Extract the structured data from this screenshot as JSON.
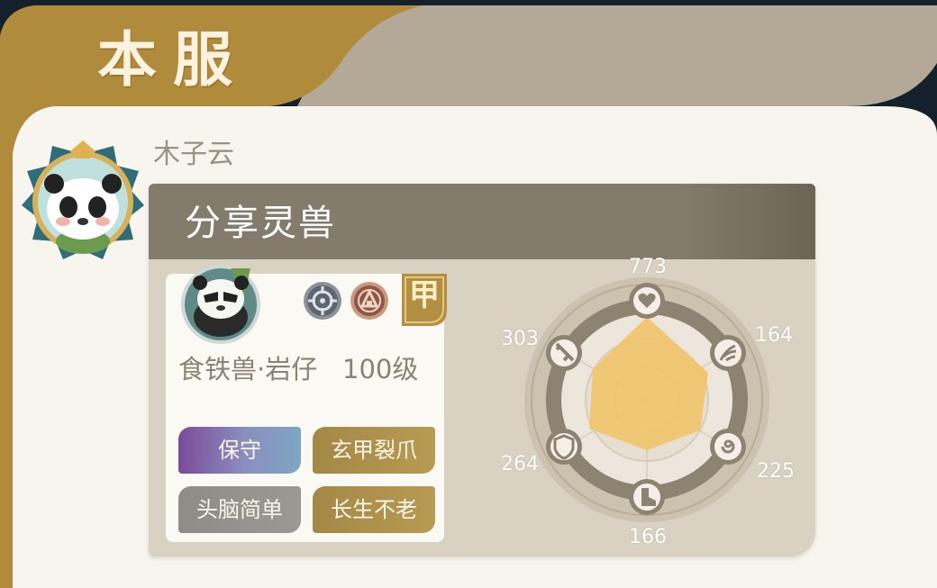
{
  "header": {
    "title": "本服"
  },
  "user": {
    "name": "木子云"
  },
  "card": {
    "title": "分享灵兽",
    "pet": {
      "name": "食铁兽·岩仔",
      "level": "100级",
      "grade": "甲",
      "traits": [
        "保守",
        "玄甲裂爪",
        "头脑简单",
        "长生不老"
      ]
    },
    "stats": {
      "top": "773",
      "top_right": "164",
      "bottom_right": "225",
      "bottom": "166",
      "bottom_left": "264",
      "top_left": "303"
    },
    "stat_icons": [
      "heart-icon",
      "claw-icon",
      "spiral-icon",
      "boot-icon",
      "shield-icon",
      "sword-icon"
    ]
  },
  "colors": {
    "gold": "#b18b3c",
    "taupe": "#b3a996",
    "panel": "#f8f5ee",
    "radar_fill": "#f1c46b"
  }
}
